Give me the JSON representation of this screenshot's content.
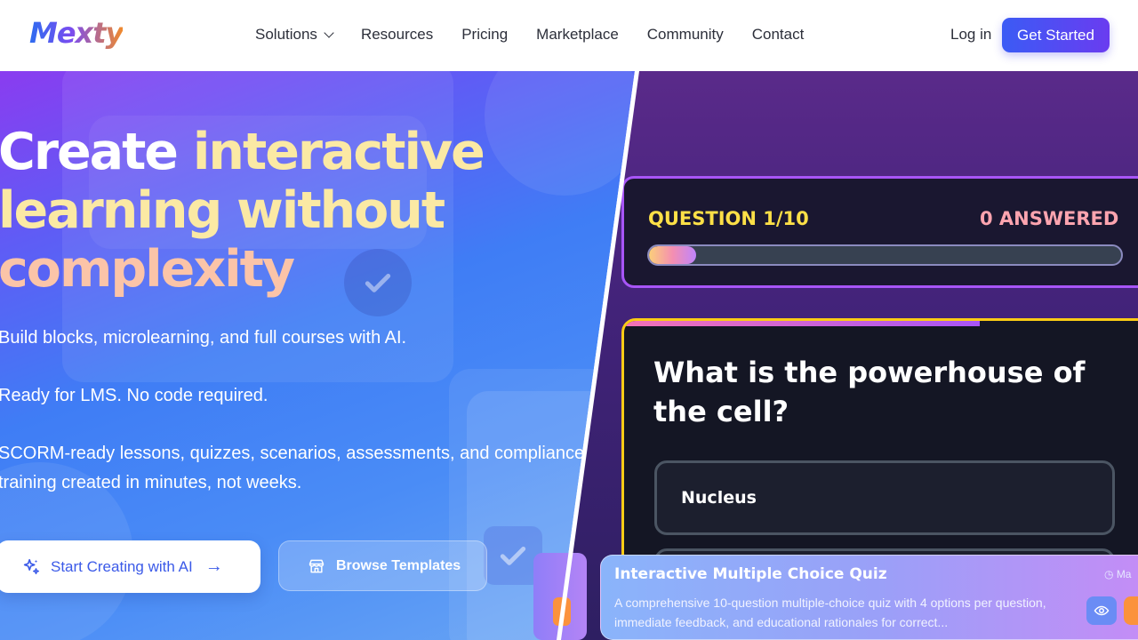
{
  "nav": {
    "logo": "Mexty",
    "links": [
      {
        "label": "Solutions",
        "has_dropdown": true
      },
      {
        "label": "Resources"
      },
      {
        "label": "Pricing"
      },
      {
        "label": "Marketplace"
      },
      {
        "label": "Community"
      },
      {
        "label": "Contact"
      }
    ],
    "login": "Log in",
    "cta": "Get Started"
  },
  "hero": {
    "headline": {
      "part1": "Create ",
      "part2": "interactive",
      "part3": "learning ",
      "part4": "without",
      "part5": "complexity"
    },
    "subtitle1": "Build blocks, microlearning, and full courses with AI.",
    "subtitle2": "Ready for LMS. No code required.",
    "subtitle3_line1": "SCORM-ready lessons, quizzes, scenarios, assessments, and compliance",
    "subtitle3_line2": "training created in minutes, not weeks.",
    "primary_button": "Start Creating with AI",
    "secondary_button": "Browse Templates"
  },
  "quiz_preview": {
    "question_counter": "QUESTION 1/10",
    "answered": "0 ANSWERED",
    "progress": 0.1,
    "question": "What is the powerhouse of the cell?",
    "options": [
      "Nucleus",
      ""
    ]
  },
  "template_card": {
    "title": "Interactive Multiple Choice Quiz",
    "description": "A comprehensive 10-question multiple-choice quiz with 4 options per question, immediate feedback, and educational rationales for correct...",
    "meta": "Ma"
  },
  "colors": {
    "brand": "#3b5bf5",
    "accent_yellow": "#facc15",
    "accent_purple": "#a855f7"
  }
}
